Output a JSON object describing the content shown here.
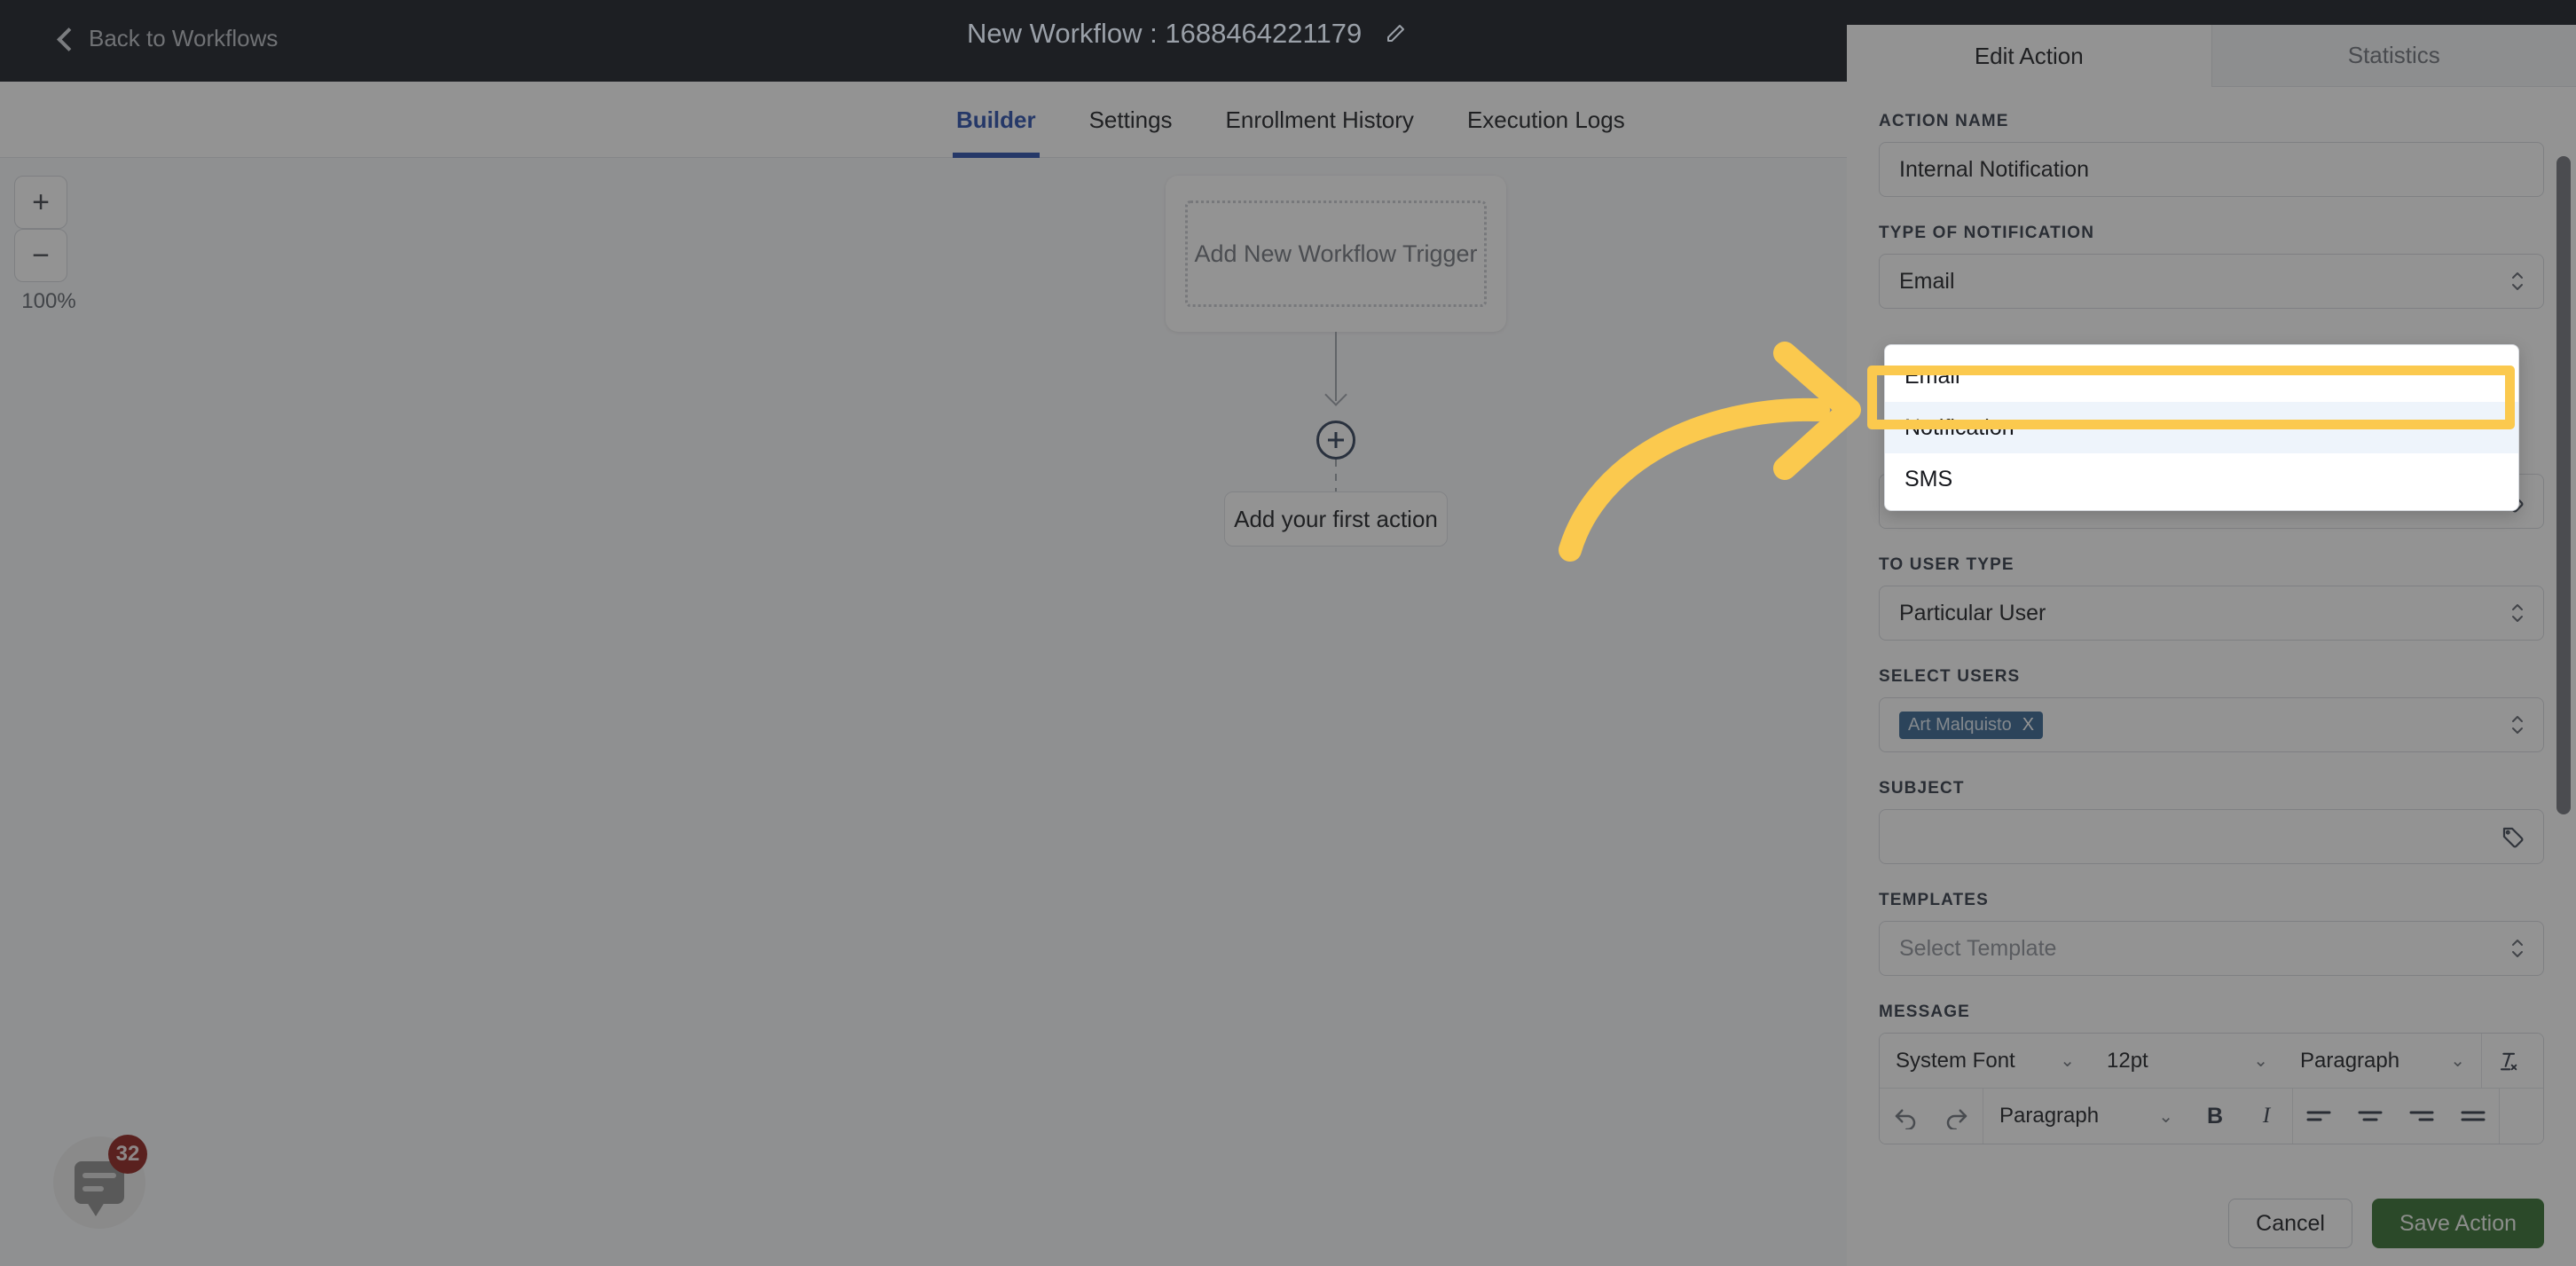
{
  "topbar": {
    "back_label": "Back to Workflows",
    "back_icon": "chevron-left-icon",
    "workflow_title": "New Workflow : 1688464221179",
    "edit_icon": "pencil-icon"
  },
  "tabs": [
    {
      "label": "Builder",
      "active": true
    },
    {
      "label": "Settings",
      "active": false
    },
    {
      "label": "Enrollment History",
      "active": false
    },
    {
      "label": "Execution Logs",
      "active": false
    }
  ],
  "canvas": {
    "zoom": {
      "in_label": "+",
      "out_label": "−",
      "level": "100%"
    },
    "trigger_card_label": "Add New Workflow Trigger",
    "add_node_icon": "plus-circle-icon",
    "first_action_label": "Add your first action",
    "chat": {
      "badge": "32",
      "icon": "chat-bubble-icon"
    }
  },
  "panel": {
    "tabs": [
      {
        "label": "Edit Action",
        "active": true
      },
      {
        "label": "Statistics",
        "active": false
      }
    ],
    "fields": {
      "action_name": {
        "label": "ACTION NAME",
        "value": "Internal Notification"
      },
      "type_of_notification": {
        "label": "TYPE OF NOTIFICATION",
        "value": "Email"
      },
      "tagged_field": {
        "value": "",
        "icon": "tag-icon"
      },
      "to_user_type": {
        "label": "TO USER TYPE",
        "value": "Particular User"
      },
      "select_users": {
        "label": "SELECT USERS",
        "chips": [
          {
            "label": "Art Malquisto",
            "remove": "X"
          }
        ]
      },
      "subject": {
        "label": "SUBJECT",
        "value": "",
        "icon": "tag-icon"
      },
      "templates": {
        "label": "TEMPLATES",
        "placeholder": "Select Template"
      },
      "message": {
        "label": "MESSAGE"
      }
    },
    "editor": {
      "row1": {
        "font": "System Font",
        "size": "12pt",
        "block": "Paragraph",
        "clear_format_icon": "clear-formatting-icon"
      },
      "row2": {
        "undo_icon": "undo-icon",
        "redo_icon": "redo-icon",
        "block": "Paragraph",
        "bold": "B",
        "italic": "I",
        "align_left_icon": "align-left-icon",
        "align_center_icon": "align-center-icon",
        "align_right_icon": "align-right-icon",
        "align_justify_icon": "align-justify-icon"
      }
    },
    "footer": {
      "cancel": "Cancel",
      "save": "Save Action"
    }
  },
  "dropdown": {
    "options": [
      {
        "label": "Email",
        "selected": false
      },
      {
        "label": "Notification",
        "selected": true
      },
      {
        "label": "SMS",
        "selected": false
      }
    ]
  },
  "annotation": {
    "arrow_icon": "curved-arrow-right-icon",
    "highlight_color": "#fbc94e",
    "arrow_color": "#fbc94e"
  }
}
